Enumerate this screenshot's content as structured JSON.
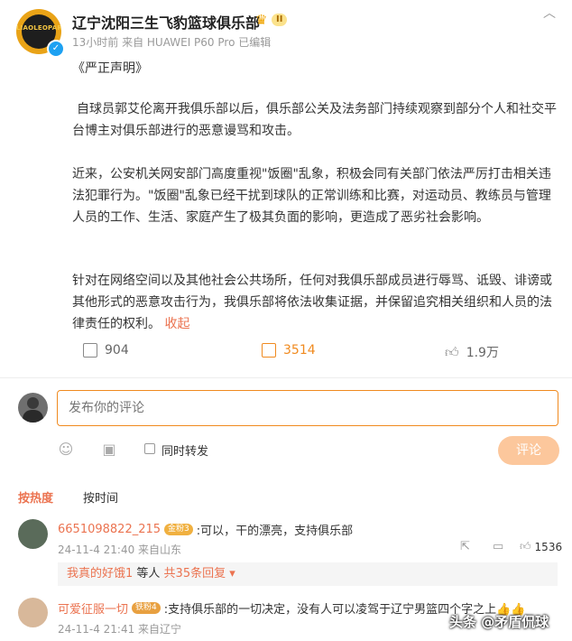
{
  "post": {
    "author_name": "辽宁沈阳三生飞豹篮球俱乐部",
    "avatar_text": "LIAOLEOPARDS",
    "level_badge": "II",
    "meta": "13小时前 来自 HUAWEI P60 Pro 已编辑",
    "title": "《严正声明》",
    "para1": "自球员郭艾伦离开我俱乐部以后，俱乐部公关及法务部门持续观察到部分个人和社交平台博主对俱乐部进行的恶意谩骂和攻击。",
    "para2": "近来，公安机关网安部门高度重视\"饭圈\"乱象，积极会同有关部门依法严厉打击相关违法犯罪行为。\"饭圈\"乱象已经干扰到球队的正常训练和比赛，对运动员、教练员与管理人员的工作、生活、家庭产生了极其负面的影响，更造成了恶劣社会影响。",
    "para3": "针对在网络空间以及其他社会公共场所，任何对我俱乐部成员进行辱骂、诋毁、诽谤或其他形式的恶意攻击行为，我俱乐部将依法收集证据，并保留追究相关组织和人员的法律责任的权利。",
    "collapse_label": "收起",
    "reposts": "904",
    "comments": "3514",
    "likes": "1.9万"
  },
  "composer": {
    "placeholder": "发布你的评论",
    "forward_label": "同时转发",
    "submit_label": "评论"
  },
  "sort": {
    "hot": "按热度",
    "time": "按时间"
  },
  "comments": [
    {
      "name": "6651098822_215",
      "badge": "金粉3",
      "text": ":可以，干的漂亮，支持俱乐部",
      "meta": "24-11-4 21:40 来自山东",
      "likes": "1536",
      "replies_user": "我真的好饿1",
      "replies_middle": " 等人 ",
      "replies_total": "共35条回复"
    },
    {
      "name": "可爱征服一切",
      "badge": "铁粉4",
      "text": ":支持俱乐部的一切决定，没有人可以凌驾于辽宁男篮四个字之上👍👍",
      "meta": "24-11-4 21:41 来自辽宁"
    }
  ],
  "watermark": "头条 @矛盾侃球",
  "colors": {
    "accent": "#eb7350",
    "comment_border": "#f08a1f",
    "submit_bg": "#fcc79c",
    "verify": "#1da1f2"
  }
}
